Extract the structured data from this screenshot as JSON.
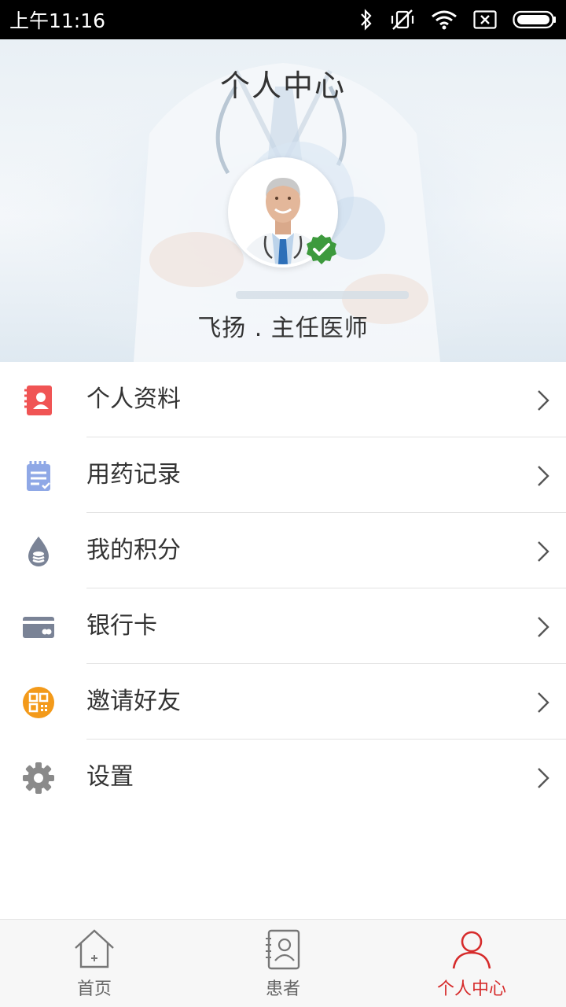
{
  "status_bar": {
    "time": "上午11:16",
    "icons": [
      "bluetooth-icon",
      "vibrate-off-icon",
      "wifi-icon",
      "sim-none-icon",
      "battery-icon"
    ]
  },
  "header": {
    "title": "个人中心",
    "doctor_name": "飞扬 . 主任医师",
    "verified_icon": "check-badge-icon"
  },
  "menu": {
    "items": [
      {
        "label": "个人资料",
        "icon": "profile-card-icon",
        "color": "#f05454"
      },
      {
        "label": "用药记录",
        "icon": "clipboard-icon",
        "color": "#8fa8e6"
      },
      {
        "label": "我的积分",
        "icon": "points-drop-icon",
        "color": "#7a8396"
      },
      {
        "label": "银行卡",
        "icon": "bank-card-icon",
        "color": "#7a8396"
      },
      {
        "label": "邀请好友",
        "icon": "qr-code-icon",
        "color": "#f39a1a"
      },
      {
        "label": "设置",
        "icon": "gear-icon",
        "color": "#8a8a8a"
      }
    ]
  },
  "bottom_nav": {
    "items": [
      {
        "label": "首页",
        "icon": "home-icon",
        "active": false
      },
      {
        "label": "患者",
        "icon": "patient-contacts-icon",
        "active": false
      },
      {
        "label": "个人中心",
        "icon": "person-icon",
        "active": true
      }
    ],
    "active_color": "#d62b2b"
  }
}
